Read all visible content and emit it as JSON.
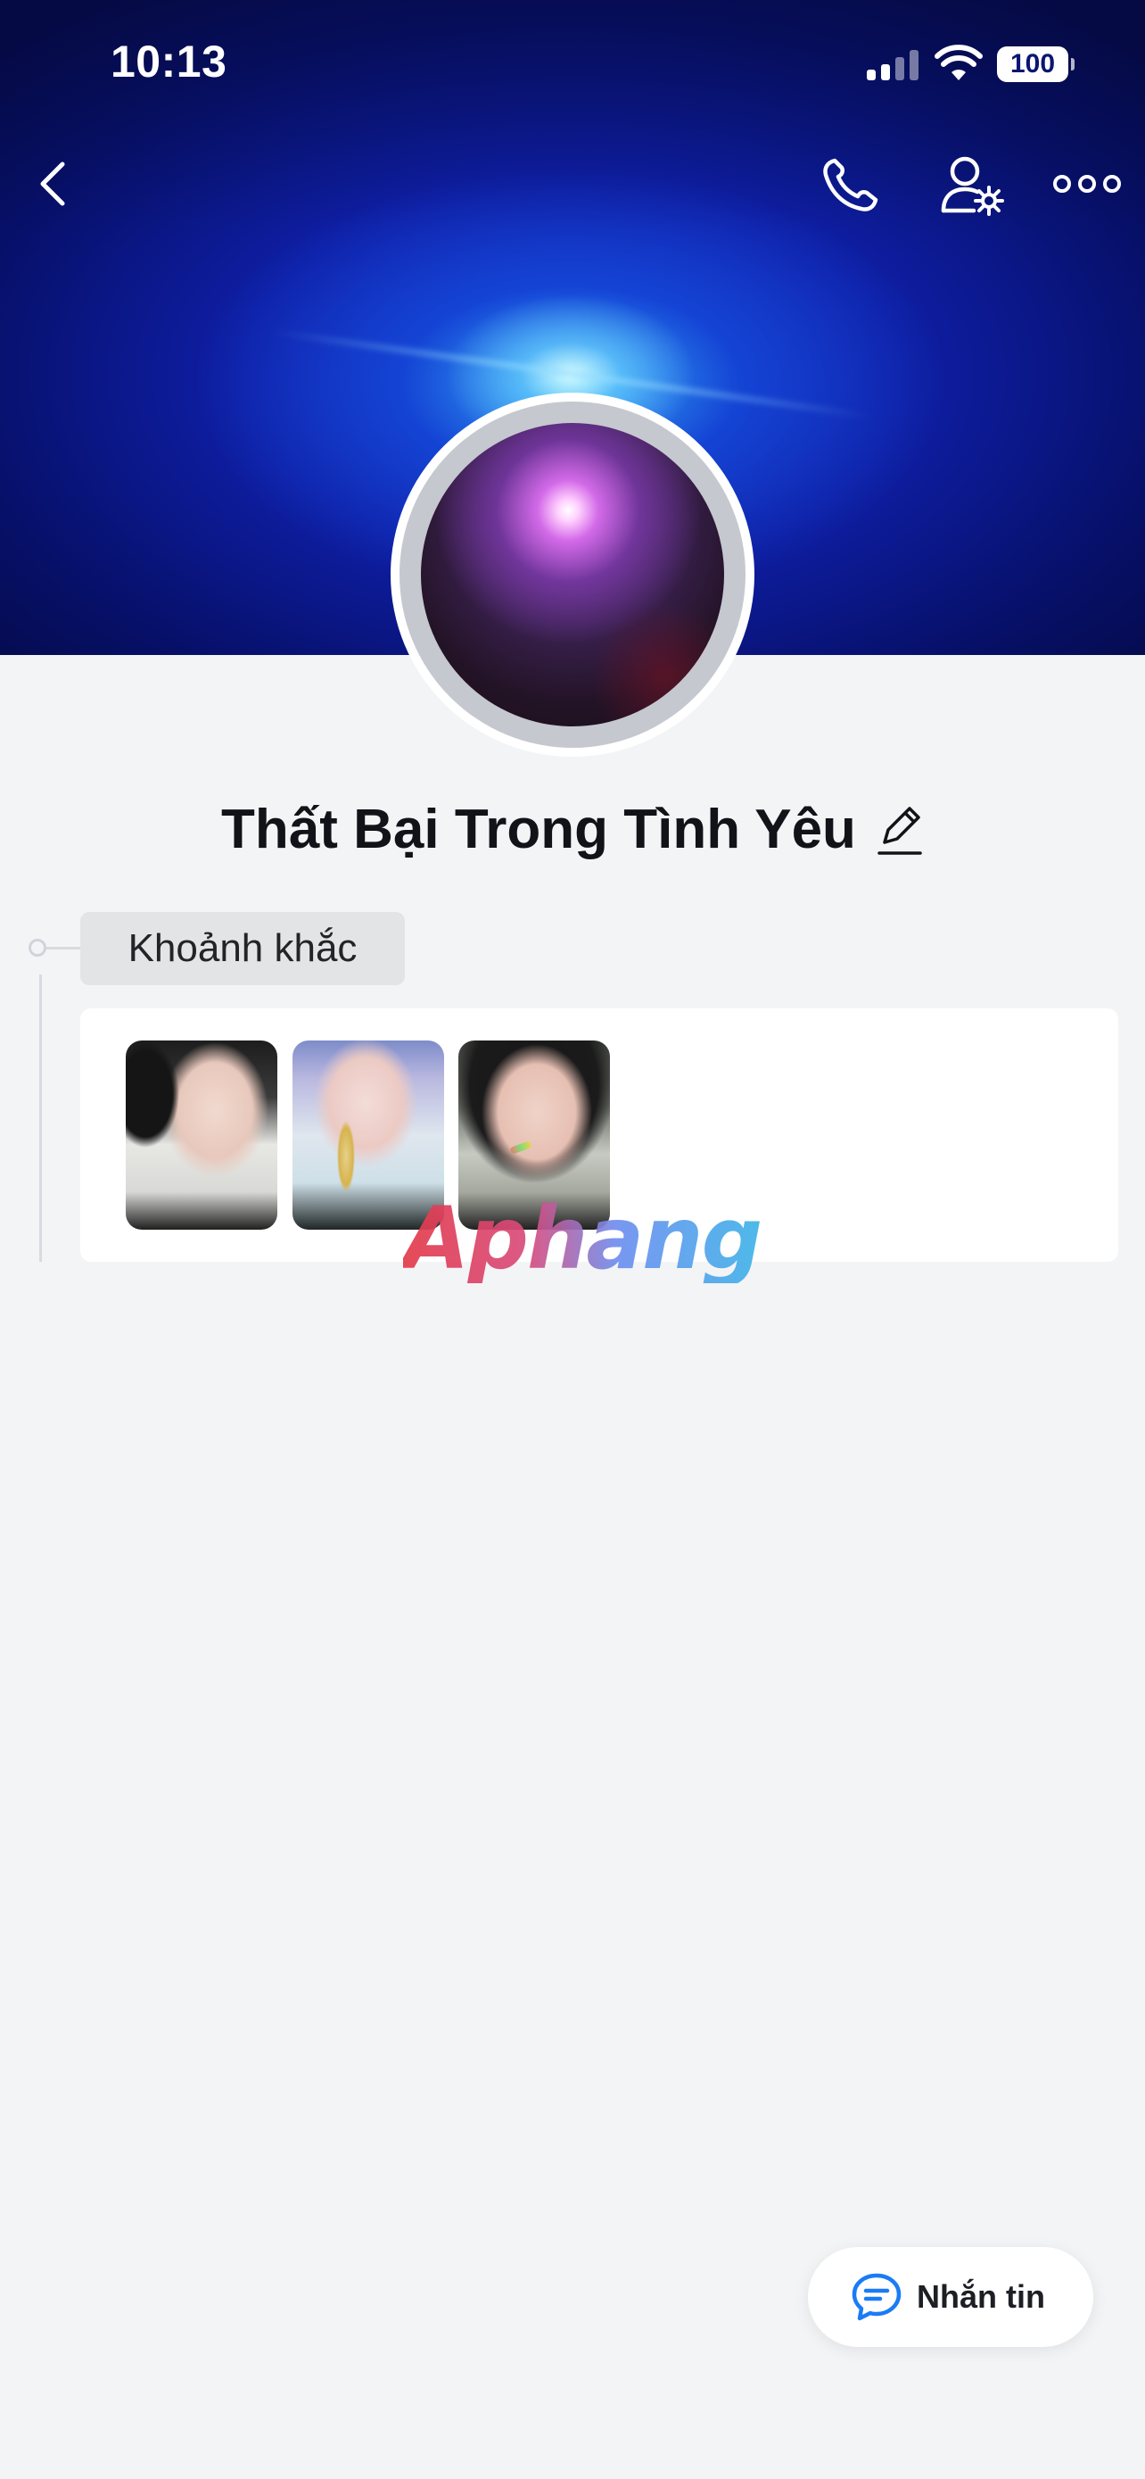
{
  "status_bar": {
    "time": "10:13",
    "battery": "100",
    "icons": [
      "signal-icon",
      "wifi-icon",
      "battery-icon"
    ]
  },
  "header": {
    "icons": [
      "back-icon",
      "phone-icon",
      "user-settings-icon",
      "more-icon"
    ]
  },
  "profile": {
    "name": "Thất Bại Trong Tình Yêu",
    "edit_icon": "pencil-icon"
  },
  "moments": {
    "label": "Khoảnh khắc",
    "thumbnail_count": 3
  },
  "watermark": {
    "text": "Aphang"
  },
  "message_button": {
    "label": "Nhắn tin",
    "icon": "chat-bubble-icon"
  },
  "colors": {
    "accent": "#1a7cf5",
    "background": "#f3f4f6",
    "name_text": "#111318",
    "cover_primary": "#0f1fa8"
  }
}
